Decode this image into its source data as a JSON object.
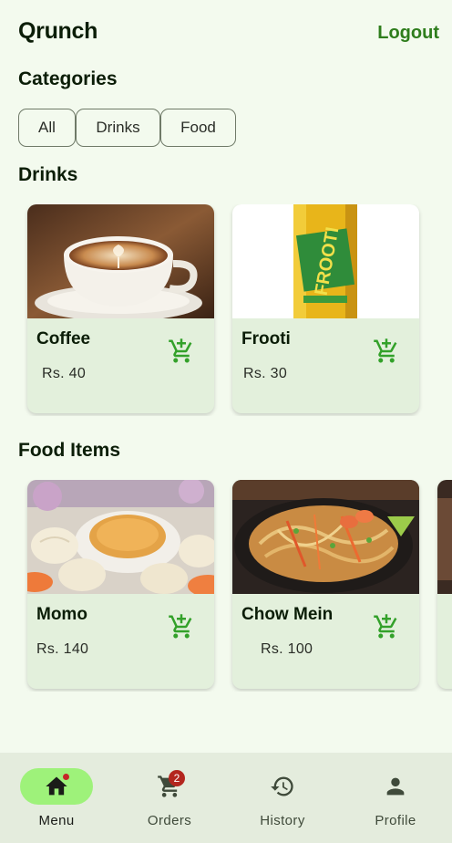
{
  "header": {
    "title": "Qrunch",
    "logout_label": "Logout"
  },
  "categories": {
    "title": "Categories",
    "chips": [
      "All",
      "Drinks",
      "Food"
    ]
  },
  "drinks": {
    "title": "Drinks",
    "items": [
      {
        "name": "Coffee",
        "price": "Rs. 40"
      },
      {
        "name": "Frooti",
        "price": "Rs. 30"
      }
    ]
  },
  "food": {
    "title": "Food Items",
    "items": [
      {
        "name": "Momo",
        "price": "Rs. 140"
      },
      {
        "name": "Chow Mein",
        "price": "Rs. 100"
      }
    ]
  },
  "nav": {
    "items": [
      {
        "label": "Menu",
        "icon": "home-icon",
        "active": true
      },
      {
        "label": "Orders",
        "icon": "shopping-cart-icon",
        "badge": "2"
      },
      {
        "label": "History",
        "icon": "history-icon"
      },
      {
        "label": "Profile",
        "icon": "person-icon"
      }
    ]
  },
  "colors": {
    "background": "#f3faee",
    "accent": "#2e7d1c",
    "card": "#e3f0dc",
    "nav_active": "#9ef27a",
    "badge": "#b3261e"
  }
}
